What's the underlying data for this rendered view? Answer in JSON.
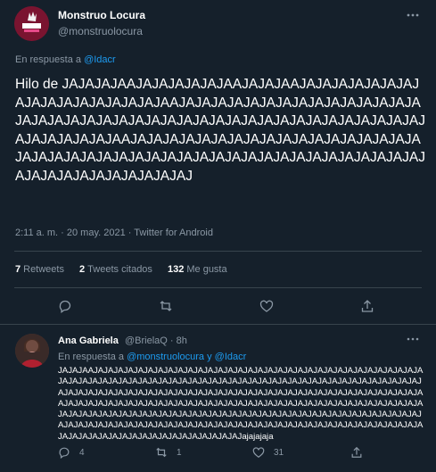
{
  "main": {
    "avatar_logo": "Monstruo Locura",
    "display_name": "Monstruo Locura",
    "handle": "@monstruolocura",
    "reply_prefix": "En respuesta a",
    "reply_mention": "@Idacr",
    "text": "Hilo de JAJAJAJAAJAJAJAJAJAJAAJAJAJAAJAJAJAJAJAJAJAJAJAJAJAJAJAJAJAJAJAAJAJAJAJAJAJAJAJAJAJAJAJAJAJAJAJAJAJAJAJAJAJAJAJAJAJAJAJAJAJAJAJAJAJAJAJAJAJAJAJAJAJAJAJAJAJAJAAJAJAJAJAJAJAJAJAJAJAJAJAJAJAJAJAJAJAJAJAJAJAJAJAJAJAJAJAJAJAJAJAJAJAJAJAJAJAJAJAJAJAJAJAJAJAJAJAJAJAJAJAJAJAJ",
    "meta": "2:11 a. m. · 20 may. 2021 · Twitter for Android",
    "stats": {
      "retweets_count": "7",
      "retweets_label": "Retweets",
      "quotes_count": "2",
      "quotes_label": "Tweets citados",
      "likes_count": "132",
      "likes_label": "Me gusta"
    }
  },
  "reply": {
    "display_name": "Ana Gabriela",
    "handle_time": "@BrielaQ · 8h",
    "reply_prefix": "En respuesta a",
    "reply_mentions": "@monstruolocura y @Idacr",
    "text": "JAJAJAAJAJAJAJAJAJAJAJAJAJAJAJAJAJAJAJAJAJAJAJAJAJAJAJAJAJAJAJAJAJAJAJAJAJAJAJAJAJAJAJAJAJAJAJAJAJAJAJAJAJAJAJAJAJAJAJAJAJAJAJAJAJAJAJAJAJAJAJAJAJAJAJAJAJAJAJAJAJAJAJAJAJAJAJAJAJAJAJAJAJAJAJAJAJAJAJAJAJAJAJAJAJAJAJAJAJAAJAJAJAJAJAJAJAJAJAJAJAJAJAJAJAJAJAJAJAJAJAJAJAJAJAJAJAJAJAJAJAJAJAJAJAJAJAJAJAJAJAJAJAJAJAJAJAJAJAJAJAJAJAJAJAJAJAJAJAJAJAJAJAJAJAJAJAJAJAJAJAJAJAJAJAJAJAJAJAJAJAJAJAJAJAJAJAJAJAJAJAJAJAJAJAJAJAJAJAJAJAJAJAJAJAJAJAJAJAJAJAJAJAJAJAJAJAJAJAJAJAJAJAJAJAJAJAJajajajaja",
    "reply_count": "4",
    "retweet_count": "1",
    "like_count": "31"
  },
  "colors": {
    "background": "#15202b",
    "secondary_text": "#8b98a5",
    "accent": "#1d9bf0",
    "divider": "#38444d"
  }
}
